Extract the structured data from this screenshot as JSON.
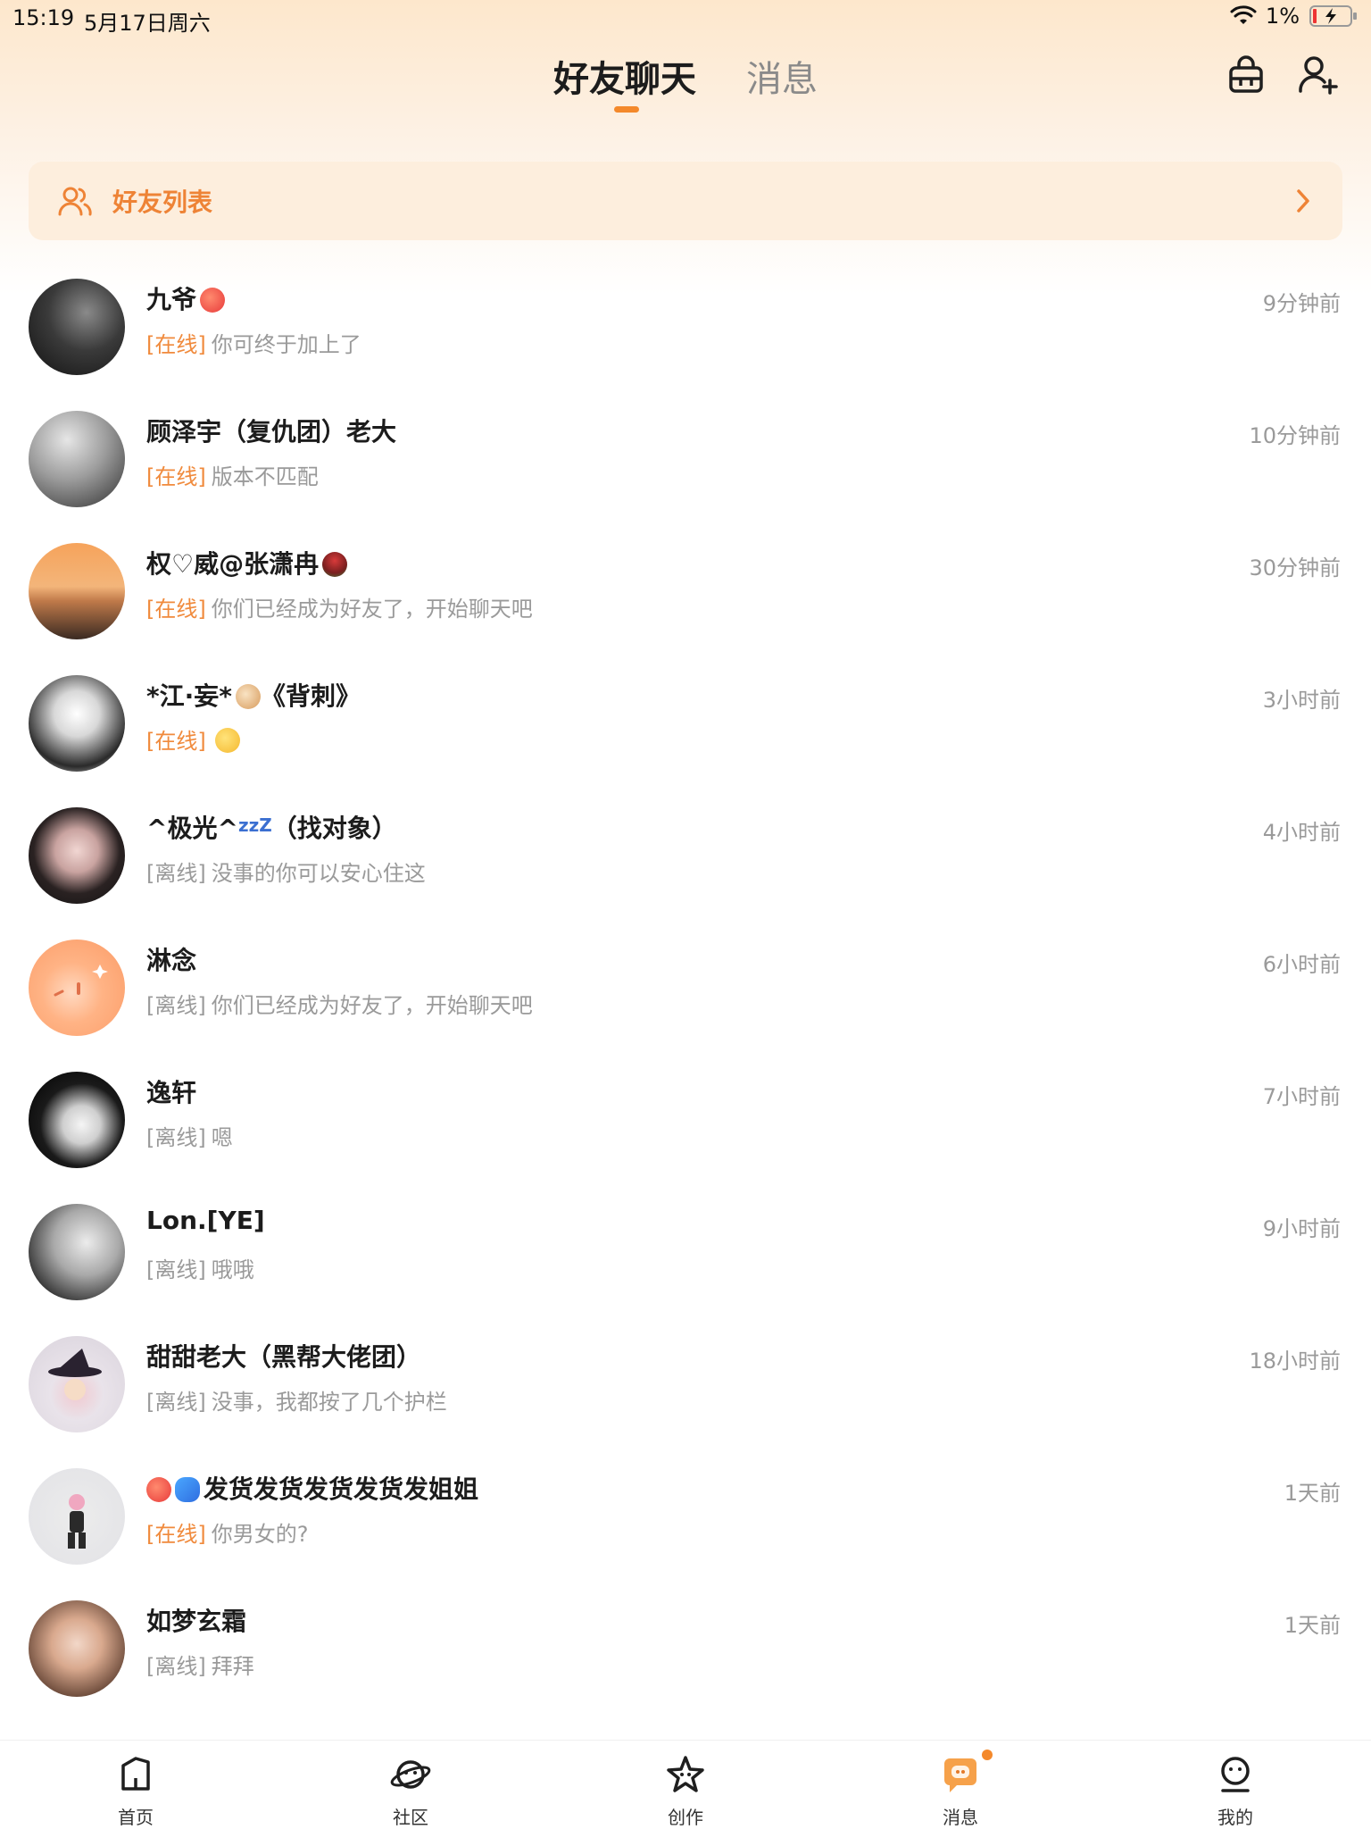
{
  "status_bar": {
    "time": "15:19",
    "date": "5月17日周六",
    "battery": "1%"
  },
  "header": {
    "tabs": [
      {
        "label": "好友聊天",
        "active": true
      },
      {
        "label": "消息",
        "active": false
      }
    ],
    "icons": [
      "shop-bag-icon",
      "add-friend-icon"
    ]
  },
  "friend_list_banner": {
    "label": "好友列表"
  },
  "chats": [
    {
      "name": "九爷",
      "time": "9分钟前",
      "status": "[在线]",
      "preview": "你可终于加上了"
    },
    {
      "name": "顾泽宇（复仇团）老大",
      "time": "10分钟前",
      "status": "[在线]",
      "preview": "版本不匹配"
    },
    {
      "name": "权♡威@张潇冉",
      "time": "30分钟前",
      "status": "[在线]",
      "preview": "你们已经成为好友了，开始聊天吧"
    },
    {
      "name_a": "*江·妄*",
      "name_b": "《背刺》",
      "time": "3小时前",
      "status": "[在线]",
      "preview": ""
    },
    {
      "name_a": "^极光^",
      "zzz": "zzZ",
      "name_b": "（找对象）",
      "time": "4小时前",
      "status": "[离线]",
      "preview": "没事的你可以安心住这"
    },
    {
      "name": "淋念",
      "time": "6小时前",
      "status": "[离线]",
      "preview": "你们已经成为好友了，开始聊天吧"
    },
    {
      "name": "逸轩",
      "time": "7小时前",
      "status": "[离线]",
      "preview": "嗯"
    },
    {
      "name": "Lon.[YE]",
      "time": "9小时前",
      "status": "[离线]",
      "preview": "哦哦"
    },
    {
      "name": "甜甜老大（黑帮大佬团）",
      "time": "18小时前",
      "status": "[离线]",
      "preview": "没事，我都按了几个护栏"
    },
    {
      "name": "发货发货发货发货发姐姐",
      "time": "1天前",
      "status": "[在线]",
      "preview": "你男女的?"
    },
    {
      "name": "如梦玄霜",
      "time": "1天前",
      "status": "[离线]",
      "preview": "拜拜"
    }
  ],
  "bottom_nav": [
    {
      "label": "首页",
      "icon": "home-icon"
    },
    {
      "label": "社区",
      "icon": "planet-icon"
    },
    {
      "label": "创作",
      "icon": "star-icon"
    },
    {
      "label": "消息",
      "icon": "message-icon",
      "active": true
    },
    {
      "label": "我的",
      "icon": "profile-icon"
    }
  ],
  "colors": {
    "accent": "#f4892b",
    "online": "#f08a3c",
    "muted": "#9a9a9a"
  }
}
